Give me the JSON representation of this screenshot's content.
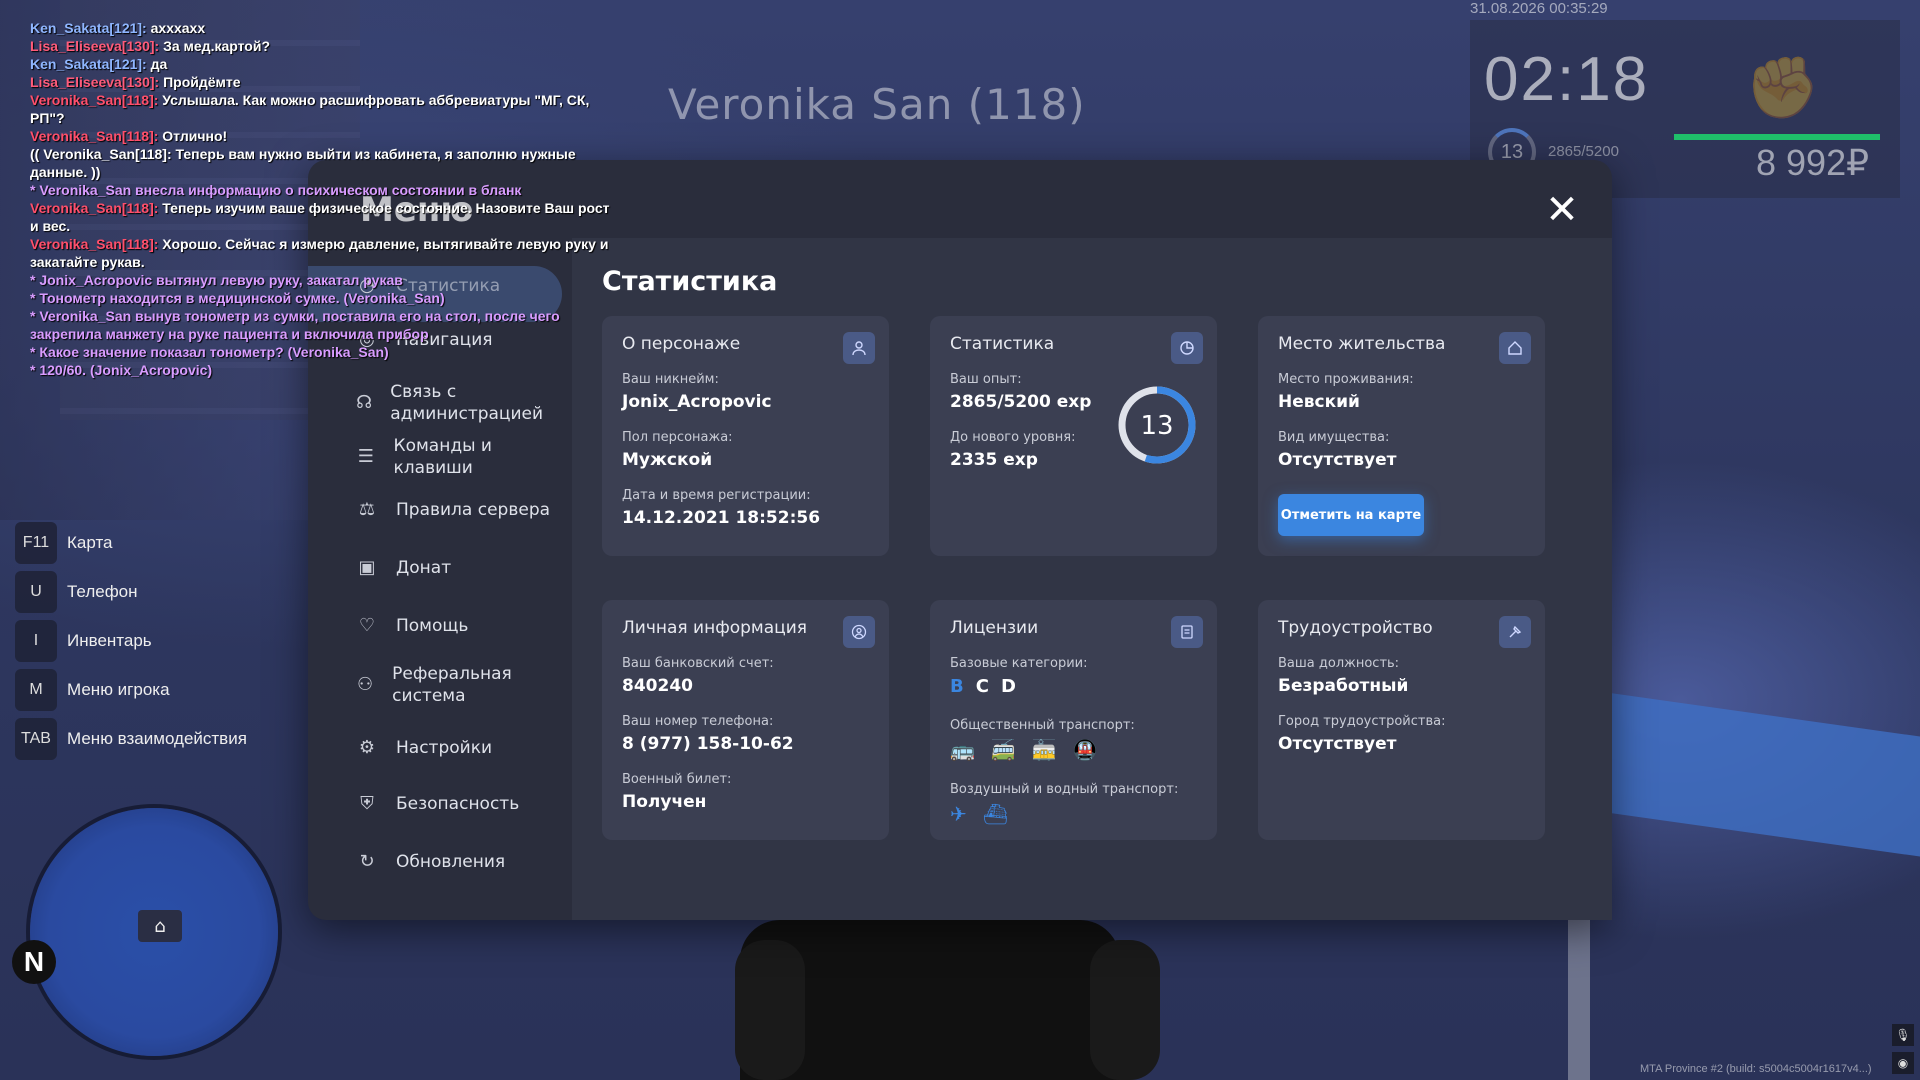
{
  "chat": [
    {
      "name": "Ken_Sakata[121]:",
      "cls": "c-ken",
      "text": "ахххахх"
    },
    {
      "name": "Lisa_Eliseeva[130]:",
      "cls": "c-lisa",
      "text": "За мед.картой?"
    },
    {
      "name": "Ken_Sakata[121]:",
      "cls": "c-ken",
      "text": "да"
    },
    {
      "name": "Lisa_Eliseeva[130]:",
      "cls": "c-lisa",
      "text": "Пройдёмте"
    },
    {
      "name": "Veronika_San[118]:",
      "cls": "c-vero",
      "text": "Услышала. Как можно расшифровать аббревиатуры \"МГ, СК, РП\"?"
    },
    {
      "name": "Veronika_San[118]:",
      "cls": "c-vero",
      "text": "Отлично!"
    },
    {
      "name": "",
      "cls": "c-txt",
      "text": "(( Veronika_San[118]: Теперь вам нужно выйти из кабинета, я заполню нужные данные. ))"
    },
    {
      "name": "",
      "cls": "c-me",
      "text": "* Veronika_San внесла информацию о психическом состоянии в бланк"
    },
    {
      "name": "Veronika_San[118]:",
      "cls": "c-vero",
      "text": "Теперь изучим ваше физическое состояние. Назовите Ваш рост и вес."
    },
    {
      "name": "Veronika_San[118]:",
      "cls": "c-vero",
      "text": "Хорошо. Сейчас я измерю давление, вытягивайте левую руку и закатайте рукав."
    },
    {
      "name": "",
      "cls": "c-me",
      "text": "* Jonix_Acropovic вытянул левую руку, закатал рукав"
    },
    {
      "name": "",
      "cls": "c-me",
      "text": "* Тонометр находится в медицинской сумке. (Veronika_San)"
    },
    {
      "name": "",
      "cls": "c-me",
      "text": "* Veronika_San вынув тонометр из сумки, поставила его на стол, после чего закрепила манжету на руке пациента и включила прибор"
    },
    {
      "name": "",
      "cls": "c-me",
      "text": "* Какое значение показал тонометр? (Veronika_San)"
    },
    {
      "name": "",
      "cls": "c-me",
      "text": "* 120/60. (Jonix_Acropovic)"
    }
  ],
  "nameplate": "Veronika San (118)",
  "hud": {
    "date": "31.08.2026 00:35:29",
    "time": "02:18",
    "level": "13",
    "exp": "2865/5200",
    "money": "8 992₽",
    "health": 1.0
  },
  "keybinds": [
    {
      "key": "F11",
      "label": "Карта"
    },
    {
      "key": "U",
      "label": "Телефон"
    },
    {
      "key": "I",
      "label": "Инвентарь"
    },
    {
      "key": "M",
      "label": "Меню игрока"
    },
    {
      "key": "TAB",
      "label": "Меню взаимодействия"
    }
  ],
  "minimap": {
    "north": "N"
  },
  "menu": {
    "title": "Меню",
    "close": "✕",
    "nav": [
      {
        "label": "Статистика",
        "icon": "stats-icon"
      },
      {
        "label": "Навигация",
        "icon": "navigation-icon"
      },
      {
        "label": "Связь с администрацией",
        "icon": "headset-icon"
      },
      {
        "label": "Команды и клавиши",
        "icon": "document-icon"
      },
      {
        "label": "Правила сервера",
        "icon": "scales-icon"
      },
      {
        "label": "Донат",
        "icon": "wallet-icon"
      },
      {
        "label": "Помощь",
        "icon": "heart-hand-icon"
      },
      {
        "label": "Реферальная система",
        "icon": "referral-icon"
      },
      {
        "label": "Настройки",
        "icon": "gear-icon"
      },
      {
        "label": "Безопасность",
        "icon": "shield-icon"
      },
      {
        "label": "Обновления",
        "icon": "refresh-icon"
      }
    ],
    "content_title": "Статистика",
    "cards": {
      "character": {
        "title": "О персонаже",
        "nick_label": "Ваш никнейм:",
        "nick": "Jonix_Acropovic",
        "gender_label": "Пол персонажа:",
        "gender": "Мужской",
        "reg_label": "Дата и время регистрации:",
        "reg": "14.12.2021 18:52:56"
      },
      "stats": {
        "title": "Статистика",
        "exp_label": "Ваш опыт:",
        "exp": "2865/5200 exp",
        "next_label": "До нового уровня:",
        "next": "2335 exp",
        "level": "13",
        "progress": 0.551
      },
      "residence": {
        "title": "Место жительства",
        "place_label": "Место проживания:",
        "place": "Невский",
        "prop_label": "Вид имущества:",
        "prop": "Отсутствует",
        "button": "Отметить на карте"
      },
      "personal": {
        "title": "Личная информация",
        "bank_label": "Ваш банковский счет:",
        "bank": "840240",
        "phone_label": "Ваш номер телефона:",
        "phone": "8 (977) 158-10-62",
        "military_label": "Военный билет:",
        "military": "Получен"
      },
      "licenses": {
        "title": "Лицензии",
        "base_label": "Базовые категории:",
        "categories": [
          {
            "c": "B",
            "active": true
          },
          {
            "c": "C",
            "active": false
          },
          {
            "c": "D",
            "active": false
          }
        ],
        "public_label": "Общественный транспорт:",
        "air_label": "Воздушный и водный транспорт:"
      },
      "job": {
        "title": "Трудоустройство",
        "pos_label": "Ваша должность:",
        "pos": "Безработный",
        "city_label": "Город трудоустройства:",
        "city": "Отсутствует"
      }
    }
  },
  "build": "MTA Province #2 (build: s5004c5004r1617v4...)"
}
